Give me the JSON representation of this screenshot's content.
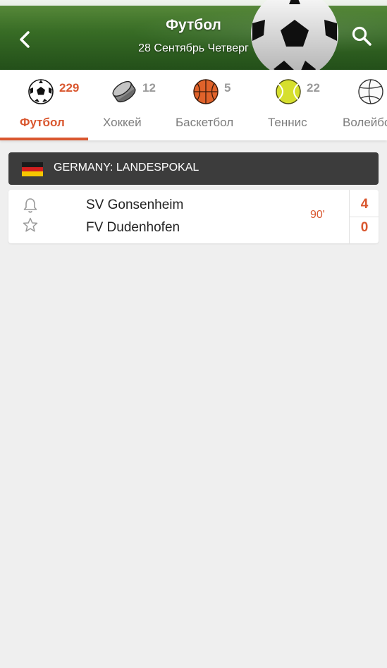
{
  "header": {
    "title": "Футбол",
    "date": "28 Сентябрь Четверг",
    "back_icon": "chevron-left-icon",
    "search_icon": "search-icon"
  },
  "sports": [
    {
      "label": "Футбол",
      "count": "229",
      "icon": "soccer-ball-icon",
      "active": true
    },
    {
      "label": "Хоккей",
      "count": "12",
      "icon": "hockey-puck-icon",
      "active": false
    },
    {
      "label": "Баскетбол",
      "count": "5",
      "icon": "basketball-icon",
      "active": false
    },
    {
      "label": "Теннис",
      "count": "22",
      "icon": "tennis-ball-icon",
      "active": false
    },
    {
      "label": "Волейбол",
      "count": "",
      "icon": "volleyball-icon",
      "active": false
    }
  ],
  "league": {
    "name": "GERMANY: LANDESPOKAL",
    "flag_icon": "germany-flag-icon"
  },
  "matches": [
    {
      "home": "SV Gonsenheim",
      "away": "FV Dudenhofen",
      "minute": "90'",
      "home_score": "4",
      "away_score": "0"
    }
  ],
  "colors": {
    "accent": "#d9572f",
    "league_bar": "#3c3c3c",
    "background": "#efefef"
  }
}
